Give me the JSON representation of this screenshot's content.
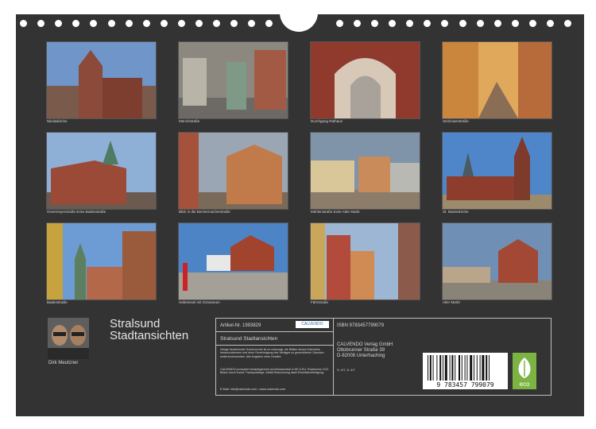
{
  "photos": [
    {
      "caption": "Nikolaikirche"
    },
    {
      "caption": "Mönchstraße"
    },
    {
      "caption": "Durchgang Rathaus"
    },
    {
      "caption": "Semlowerstraße"
    },
    {
      "caption": "Ossenreyerstraße Ecke Badenstraße"
    },
    {
      "caption": "Blick in die Bechermacherstraße"
    },
    {
      "caption": "Mühlenstraße Ecke Alter Markt"
    },
    {
      "caption": "St. Marienkirche"
    },
    {
      "caption": "Badenstraße"
    },
    {
      "caption": "Hafeninsel mit Ozeaneum"
    },
    {
      "caption": "Fährstraße"
    },
    {
      "caption": "Alter Markt"
    }
  ],
  "author": "Dirk Meutzner",
  "title_line1": "Stralsund",
  "title_line2": "Stadtansichten",
  "article_no": "Artikel-Nr. 1993829",
  "calvendo_badge": "CALVENDO",
  "product_title": "Stralsund Stadtansichten",
  "legal_text": "Infolge bestehender Schutzrechte ist es untersagt, die Blätter dieses Kalenders herauszutrennen und ohne Genehmigung des Verlages zu gewerblichen Zwecken weiterzuverwenden. Alle Angaben ohne Gewähr.",
  "production_text": "CALVENDO produziert bedarfsgerecht und klimaneutral in DE & EU. Positiveres CO2-Bilanz durch kurzer Transportwege, Abfall-Reduzierung dank Einzelstückfertigung.",
  "contact": "E-Mail: info@calvendo.com • www.calvendo.com",
  "isbn": "ISBN 9783457799079",
  "publisher_line1": "CALVENDO Verlag GmbH",
  "publisher_line2": "Ottobrunner Straße 39",
  "publisher_line3": "D-82008 Unterhaching",
  "code_small": "S: 4/7, 8: 4/7",
  "barcode_number": "9 783457 799079",
  "colors": {
    "background": "#333333",
    "text": "#d8d8d8",
    "eco": "#7cb342"
  }
}
